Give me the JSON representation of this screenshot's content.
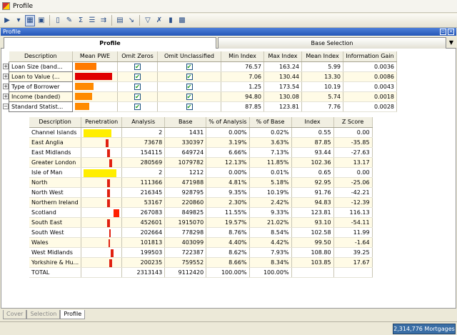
{
  "window": {
    "title": "Profile"
  },
  "toolbar": {
    "icons": [
      "run-icon",
      "profile-view-icon",
      "save-icon",
      "page-icon",
      "wand-icon",
      "sigma-icon",
      "field-list-icon",
      "merge-icon",
      "grid-icon",
      "export-icon",
      "filter-icon",
      "clear-filter-icon",
      "chart-icon",
      "image-icon"
    ]
  },
  "panel": {
    "title": "Profile"
  },
  "tabs": {
    "profile": "Profile",
    "base": "Base Selection"
  },
  "main": {
    "headers": [
      "Description",
      "Mean PWE",
      "Omit Zeros",
      "Omit Unclassified",
      "Min Index",
      "Max Index",
      "Mean Index",
      "Information Gain"
    ],
    "rows": [
      {
        "desc": "Loan Size (band...",
        "pwe": 0.58,
        "pwe_color": "#ff7a00",
        "omit_zeros": "✔",
        "omit_unclassified": "✔",
        "min": "76.57",
        "max": "163.24",
        "mean": "5.99",
        "gain": "0.0036",
        "expander": "+"
      },
      {
        "desc": "Loan to Value (...",
        "pwe": 1.0,
        "pwe_color": "#e00000",
        "omit_zeros": "✔",
        "omit_unclassified": "✔",
        "min": "7.06",
        "max": "130.44",
        "mean": "13.30",
        "gain": "0.0086",
        "expander": "+"
      },
      {
        "desc": "Type of Borrower",
        "pwe": 0.5,
        "pwe_color": "#ff8a00",
        "omit_zeros": "✔",
        "omit_unclassified": "✔",
        "min": "1.25",
        "max": "173.54",
        "mean": "10.19",
        "gain": "0.0043",
        "expander": "+"
      },
      {
        "desc": "Income (banded)",
        "pwe": 0.46,
        "pwe_color": "#ff8a00",
        "omit_zeros": "✔",
        "omit_unclassified": "✔",
        "min": "94.80",
        "max": "130.08",
        "mean": "5.74",
        "gain": "0.0018",
        "expander": "+"
      },
      {
        "desc": "Standard Statist...",
        "pwe": 0.38,
        "pwe_color": "#ff8a00",
        "omit_zeros": "✔",
        "omit_unclassified": "✔",
        "min": "87.85",
        "max": "123.81",
        "mean": "7.76",
        "gain": "0.0028",
        "expander": "−"
      }
    ]
  },
  "sub": {
    "headers": [
      "Description",
      "Penetration",
      "Analysis",
      "Base",
      "% of Analysis",
      "% of Base",
      "Index",
      "Z Score"
    ],
    "rows": [
      {
        "desc": "Channel Islands",
        "pen": 0.55,
        "pen_kind": "low",
        "analysis": "2",
        "base": "1431",
        "pa": "0.00%",
        "pb": "0.02%",
        "index": "0.55",
        "z": "0.00"
      },
      {
        "desc": "East Anglia",
        "pen": 0.88,
        "pen_kind": "mid",
        "analysis": "73678",
        "base": "330397",
        "pa": "3.19%",
        "pb": "3.63%",
        "index": "87.85",
        "z": "-35.85"
      },
      {
        "desc": "East Midlands",
        "pen": 0.93,
        "pen_kind": "mid",
        "analysis": "154115",
        "base": "649724",
        "pa": "6.66%",
        "pb": "7.13%",
        "index": "93.44",
        "z": "-27.63"
      },
      {
        "desc": "Greater London",
        "pen": 1.02,
        "pen_kind": "mid",
        "analysis": "280569",
        "base": "1079782",
        "pa": "12.13%",
        "pb": "11.85%",
        "index": "102.36",
        "z": "13.17"
      },
      {
        "desc": "Isle of Man",
        "pen": 0.65,
        "pen_kind": "low",
        "analysis": "2",
        "base": "1212",
        "pa": "0.00%",
        "pb": "0.01%",
        "index": "0.65",
        "z": "0.00"
      },
      {
        "desc": "North",
        "pen": 0.93,
        "pen_kind": "mid",
        "analysis": "111366",
        "base": "471988",
        "pa": "4.81%",
        "pb": "5.18%",
        "index": "92.95",
        "z": "-25.06"
      },
      {
        "desc": "North West",
        "pen": 0.92,
        "pen_kind": "mid",
        "analysis": "216345",
        "base": "928795",
        "pa": "9.35%",
        "pb": "10.19%",
        "index": "91.76",
        "z": "-42.21"
      },
      {
        "desc": "Northern Ireland",
        "pen": 0.95,
        "pen_kind": "mid",
        "analysis": "53167",
        "base": "220860",
        "pa": "2.30%",
        "pb": "2.42%",
        "index": "94.83",
        "z": "-12.39"
      },
      {
        "desc": "Scotland",
        "pen": 1.24,
        "pen_kind": "high",
        "analysis": "267083",
        "base": "849825",
        "pa": "11.55%",
        "pb": "9.33%",
        "index": "123.81",
        "z": "116.13"
      },
      {
        "desc": "South East",
        "pen": 0.93,
        "pen_kind": "mid",
        "analysis": "452601",
        "base": "1915070",
        "pa": "19.57%",
        "pb": "21.02%",
        "index": "93.10",
        "z": "-54.11"
      },
      {
        "desc": "South West",
        "pen": 1.03,
        "pen_kind": "thin",
        "analysis": "202664",
        "base": "778298",
        "pa": "8.76%",
        "pb": "8.54%",
        "index": "102.58",
        "z": "11.99"
      },
      {
        "desc": "Wales",
        "pen": 1.0,
        "pen_kind": "thin",
        "analysis": "101813",
        "base": "403099",
        "pa": "4.40%",
        "pb": "4.42%",
        "index": "99.50",
        "z": "-1.64"
      },
      {
        "desc": "West Midlands",
        "pen": 1.09,
        "pen_kind": "mid",
        "analysis": "199503",
        "base": "722387",
        "pa": "8.62%",
        "pb": "7.93%",
        "index": "108.80",
        "z": "39.25"
      },
      {
        "desc": "Yorkshire  & Hu...",
        "pen": 1.04,
        "pen_kind": "mid",
        "analysis": "200235",
        "base": "759552",
        "pa": "8.66%",
        "pb": "8.34%",
        "index": "103.85",
        "z": "17.67"
      },
      {
        "desc": "TOTAL",
        "pen": null,
        "pen_kind": "none",
        "analysis": "2313143",
        "base": "9112420",
        "pa": "100.00%",
        "pb": "100.00%",
        "index": "",
        "z": ""
      }
    ]
  },
  "bottom_tabs": [
    "Cover",
    "Selection",
    "Profile"
  ],
  "status": {
    "count": "2,314,776 Mortgages"
  },
  "colors": {
    "accent": "#2557b8",
    "low": "#ffee00",
    "mid": "#e02010",
    "high": "#ff2000"
  }
}
